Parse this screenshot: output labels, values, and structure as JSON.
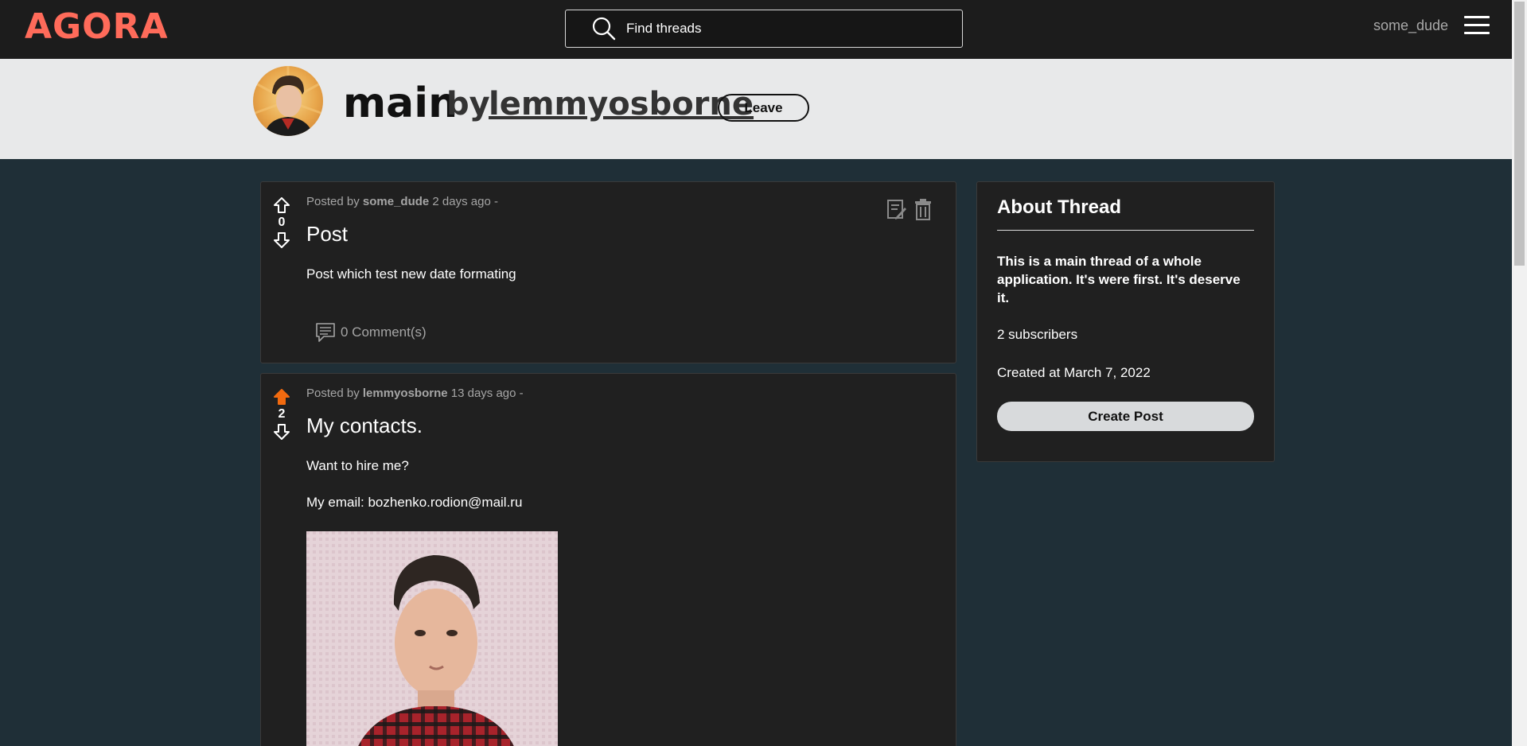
{
  "header": {
    "logo_text": "AGORA",
    "search_placeholder": "Find threads",
    "username": "some_dude",
    "brand_color": "#ff6b5a"
  },
  "thread": {
    "name": "main",
    "by_label": "by",
    "author": "lemmyosborne",
    "leave_label": "Leave"
  },
  "posts": [
    {
      "posted_by_label": "Posted by",
      "author": "some_dude",
      "time": "2 days ago",
      "separator": "-",
      "vote_count": "0",
      "upvoted": false,
      "title": "Post",
      "body": [
        "Post which test new date formating"
      ],
      "comments_label": "0 Comment(s)",
      "actions": [
        "edit-icon",
        "trash-icon"
      ]
    },
    {
      "posted_by_label": "Posted by",
      "author": "lemmyosborne",
      "time": "13 days ago",
      "separator": "-",
      "vote_count": "2",
      "upvoted": true,
      "title": "My contacts.",
      "body": [
        "Want to hire me?",
        "My email: bozhenko.rodion@mail.ru"
      ],
      "upvote_color": "#f26a0f"
    }
  ],
  "about": {
    "title": "About Thread",
    "description": "This is a main thread of a whole application. It's were first. It's deserve it.",
    "subscribers": "2 subscribers",
    "created": "Created at March 7, 2022",
    "create_post_label": "Create Post"
  }
}
